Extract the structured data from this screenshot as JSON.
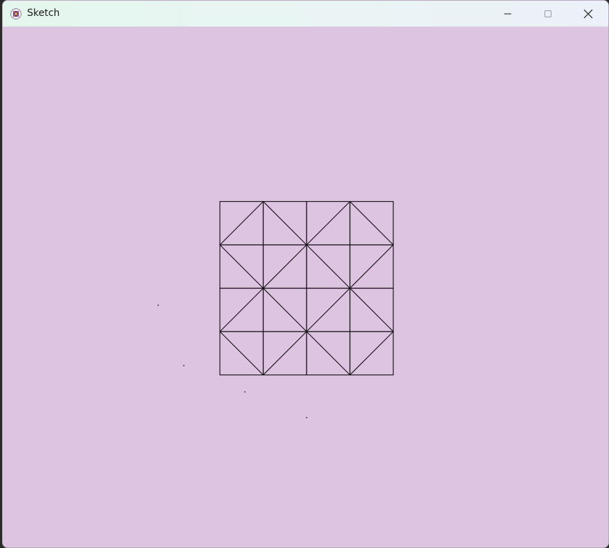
{
  "window": {
    "title": "Sketch",
    "background_color": "#ddc5e1",
    "icons": {
      "app": "processing-sketch-icon",
      "minimize": "minimize-icon",
      "maximize": "maximize-icon",
      "close": "close-icon"
    }
  },
  "sketch": {
    "grid_rows": 4,
    "grid_cols": 4,
    "stroke_color": "#1c141c",
    "diagonals": [
      [
        "ne",
        "nw",
        "ne",
        "nw"
      ],
      [
        "nw",
        "ne",
        "nw",
        "ne"
      ],
      [
        "ne",
        "nw",
        "ne",
        "nw"
      ],
      [
        "nw",
        "ne",
        "nw",
        "ne"
      ]
    ],
    "stray_dot_count": 4
  }
}
